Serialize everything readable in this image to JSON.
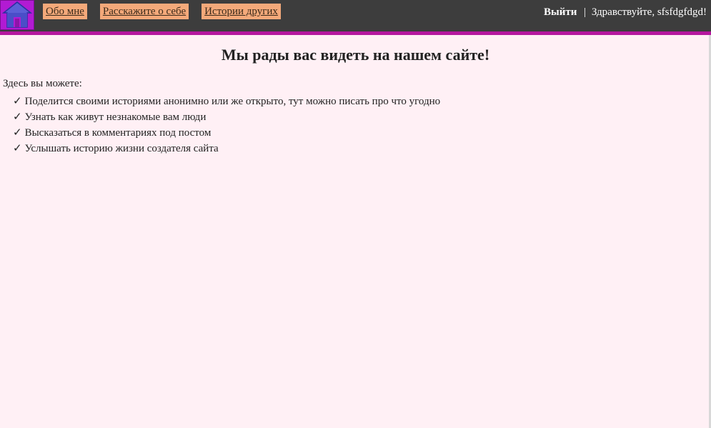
{
  "nav": {
    "home_icon": "home-icon",
    "links": [
      {
        "label": "Обо мне"
      },
      {
        "label": "Расскажите о себе"
      },
      {
        "label": "Истории других"
      }
    ],
    "logout_label": "Выйти",
    "separator": "|",
    "greeting": "Здравствуйте, sfsfdgfdgd!"
  },
  "main": {
    "title": "Мы рады вас видеть на нашем сайте!",
    "intro": "Здесь вы можете:",
    "check_glyph": "✓",
    "features": [
      "Поделится своими историями анонимно или же открыто, тут можно писать про что угодно",
      "Узнать как живут незнакомые вам люди",
      "Высказаться в комментариях под постом",
      "Услышать историю жизни создателя сайта"
    ]
  },
  "colors": {
    "navbar": "#3d3d3d",
    "navbar_border": "#b5179e",
    "home_bg": "#b21bd3",
    "link_bg": "#f4a97a",
    "page_bg": "#fff0f5"
  }
}
